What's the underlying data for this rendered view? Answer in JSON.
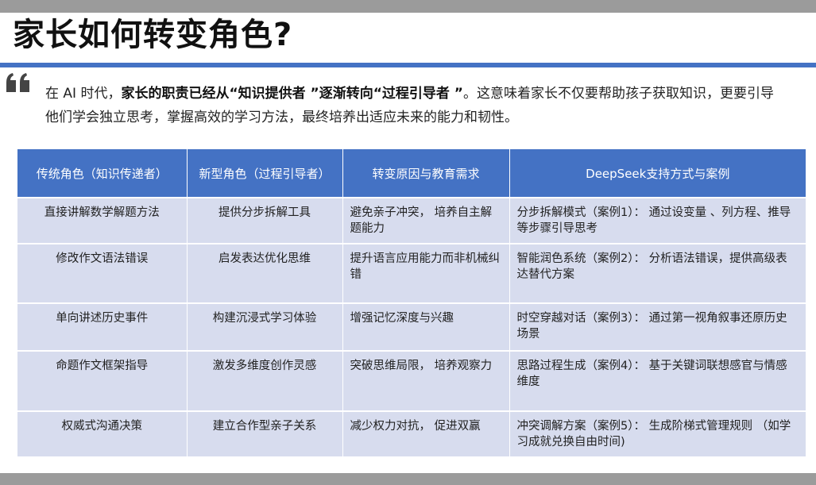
{
  "title": "家长如何转变角色?",
  "intro": {
    "p1": "在 AI 时代，",
    "b1": "家长的职责已经从“知识提供者 ”逐渐转向“过程引导者 ”",
    "p2": "。这意味着家长不仅要帮助孩子获取知识，更要引导他们学会独立思考，掌握高效的学习方法，最终培养出适应未来的能力和韧性。"
  },
  "table": {
    "headers": [
      "传统角色（知识传递者）",
      "新型角色（过程引导者）",
      "转变原因与教育需求",
      "DeepSeek支持方式与案例"
    ],
    "rows": [
      [
        "直接讲解数学解题方法",
        "提供分步拆解工具",
        "避免亲子冲突， 培养自主解题能力",
        "分步拆解模式（案例1）： 通过设变量 、列方程、推导等步骤引导思考"
      ],
      [
        "修改作文语法错误",
        "启发表达优化思维",
        "提升语言应用能力而非机械纠错",
        "智能润色系统（案例2）： 分析语法错误，提供高级表达替代方案"
      ],
      [
        "单向讲述历史事件",
        "构建沉浸式学习体验",
        "增强记忆深度与兴趣",
        "时空穿越对话（案例3）： 通过第一视角叙事还原历史场景"
      ],
      [
        "命题作文框架指导",
        "激发多维度创作灵感",
        "突破思维局限， 培养观察力",
        "思路过程生成（案例4）： 基于关键词联想感官与情感维度"
      ],
      [
        "权威式沟通决策",
        "建立合作型亲子关系",
        "减少权力对抗， 促进双赢",
        "冲突调解方案（案例5）： 生成阶梯式管理规则 （如学习成就兑换自由时间)"
      ]
    ]
  },
  "colors": {
    "accent": "#4472c4",
    "cell_bg": "#d7dcee",
    "bar": "#9b9b9b"
  },
  "icons": {
    "quote": "quote-mark-icon"
  }
}
